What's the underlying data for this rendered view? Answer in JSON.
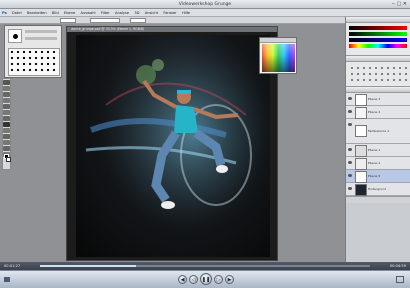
{
  "window": {
    "title": "Videowerkshop Grunge"
  },
  "menu": [
    "Datei",
    "Bearbeiten",
    "Bild",
    "Ebene",
    "Auswahl",
    "Filter",
    "Analyse",
    "3D",
    "Ansicht",
    "Fenster",
    "Hilfe"
  ],
  "document": {
    "tab_title": "dance_grunge.psd @ 33,3% (Ebene 1, RGB/8)"
  },
  "layers": [
    {
      "label": "Ebene 3"
    },
    {
      "label": "Ebene 2"
    },
    {
      "label": "Farbbalance 1"
    },
    {
      "label": "Ebene 1"
    },
    {
      "label": "Ebene 4"
    },
    {
      "label": "Ebene 5"
    },
    {
      "label": "Hintergrund"
    }
  ],
  "status": {
    "time_left": "00:01:27",
    "time_right": "00:04:59"
  },
  "colors": {
    "accent": "#1a7fd3",
    "workspace": "#8f9195"
  }
}
